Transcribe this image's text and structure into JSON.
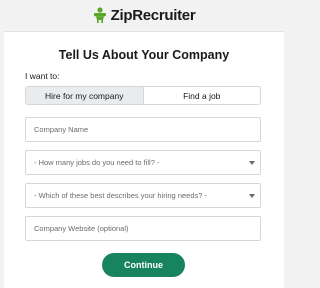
{
  "brand": {
    "name": "ZipRecruiter",
    "icon": "ziprecruiter-logo-icon",
    "accent_color": "#5ba829"
  },
  "form": {
    "title": "Tell Us About Your Company",
    "i_want_to_label": "I want to:",
    "toggle": {
      "options": [
        "Hire for my company",
        "Find a job"
      ],
      "selected": "Hire for my company"
    },
    "company_name": {
      "placeholder": "Company Name",
      "value": ""
    },
    "jobs_select": {
      "selected": "- How many jobs do you need to fill? -"
    },
    "needs_select": {
      "selected": "- Which of these best describes your hiring needs? -"
    },
    "website": {
      "placeholder": "Company Website (optional)",
      "value": ""
    },
    "continue_label": "Continue",
    "button_color": "#18845f"
  }
}
